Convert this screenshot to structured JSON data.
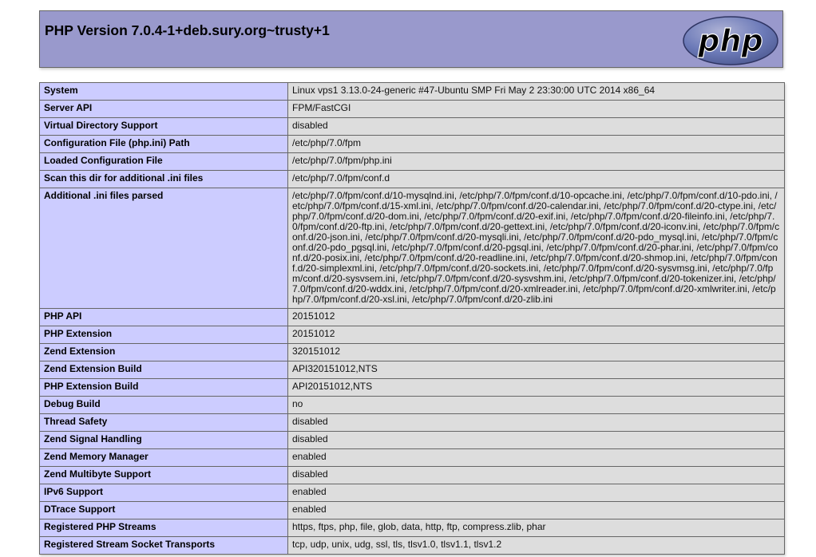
{
  "header": {
    "title": "PHP Version 7.0.4-1+deb.sury.org~trusty+1",
    "logo_text": "php"
  },
  "rows": [
    {
      "label": "System",
      "value": "Linux vps1 3.13.0-24-generic #47-Ubuntu SMP Fri May 2 23:30:00 UTC 2014 x86_64"
    },
    {
      "label": "Server API",
      "value": "FPM/FastCGI"
    },
    {
      "label": "Virtual Directory Support",
      "value": "disabled"
    },
    {
      "label": "Configuration File (php.ini) Path",
      "value": "/etc/php/7.0/fpm"
    },
    {
      "label": "Loaded Configuration File",
      "value": "/etc/php/7.0/fpm/php.ini"
    },
    {
      "label": "Scan this dir for additional .ini files",
      "value": "/etc/php/7.0/fpm/conf.d"
    },
    {
      "label": "Additional .ini files parsed",
      "value": "/etc/php/7.0/fpm/conf.d/10-mysqlnd.ini, /etc/php/7.0/fpm/conf.d/10-opcache.ini, /etc/php/7.0/fpm/conf.d/10-pdo.ini, /etc/php/7.0/fpm/conf.d/15-xml.ini, /etc/php/7.0/fpm/conf.d/20-calendar.ini, /etc/php/7.0/fpm/conf.d/20-ctype.ini, /etc/php/7.0/fpm/conf.d/20-dom.ini, /etc/php/7.0/fpm/conf.d/20-exif.ini, /etc/php/7.0/fpm/conf.d/20-fileinfo.ini, /etc/php/7.0/fpm/conf.d/20-ftp.ini, /etc/php/7.0/fpm/conf.d/20-gettext.ini, /etc/php/7.0/fpm/conf.d/20-iconv.ini, /etc/php/7.0/fpm/conf.d/20-json.ini, /etc/php/7.0/fpm/conf.d/20-mysqli.ini, /etc/php/7.0/fpm/conf.d/20-pdo_mysql.ini, /etc/php/7.0/fpm/conf.d/20-pdo_pgsql.ini, /etc/php/7.0/fpm/conf.d/20-pgsql.ini, /etc/php/7.0/fpm/conf.d/20-phar.ini, /etc/php/7.0/fpm/conf.d/20-posix.ini, /etc/php/7.0/fpm/conf.d/20-readline.ini, /etc/php/7.0/fpm/conf.d/20-shmop.ini, /etc/php/7.0/fpm/conf.d/20-simplexml.ini, /etc/php/7.0/fpm/conf.d/20-sockets.ini, /etc/php/7.0/fpm/conf.d/20-sysvmsg.ini, /etc/php/7.0/fpm/conf.d/20-sysvsem.ini, /etc/php/7.0/fpm/conf.d/20-sysvshm.ini, /etc/php/7.0/fpm/conf.d/20-tokenizer.ini, /etc/php/7.0/fpm/conf.d/20-wddx.ini, /etc/php/7.0/fpm/conf.d/20-xmlreader.ini, /etc/php/7.0/fpm/conf.d/20-xmlwriter.ini, /etc/php/7.0/fpm/conf.d/20-xsl.ini, /etc/php/7.0/fpm/conf.d/20-zlib.ini"
    },
    {
      "label": "PHP API",
      "value": "20151012"
    },
    {
      "label": "PHP Extension",
      "value": "20151012"
    },
    {
      "label": "Zend Extension",
      "value": "320151012"
    },
    {
      "label": "Zend Extension Build",
      "value": "API320151012,NTS"
    },
    {
      "label": "PHP Extension Build",
      "value": "API20151012,NTS"
    },
    {
      "label": "Debug Build",
      "value": "no"
    },
    {
      "label": "Thread Safety",
      "value": "disabled"
    },
    {
      "label": "Zend Signal Handling",
      "value": "disabled"
    },
    {
      "label": "Zend Memory Manager",
      "value": "enabled"
    },
    {
      "label": "Zend Multibyte Support",
      "value": "disabled"
    },
    {
      "label": "IPv6 Support",
      "value": "enabled"
    },
    {
      "label": "DTrace Support",
      "value": "enabled"
    },
    {
      "label": "Registered PHP Streams",
      "value": "https, ftps, php, file, glob, data, http, ftp, compress.zlib, phar"
    },
    {
      "label": "Registered Stream Socket Transports",
      "value": "tcp, udp, unix, udg, ssl, tls, tlsv1.0, tlsv1.1, tlsv1.2"
    }
  ]
}
